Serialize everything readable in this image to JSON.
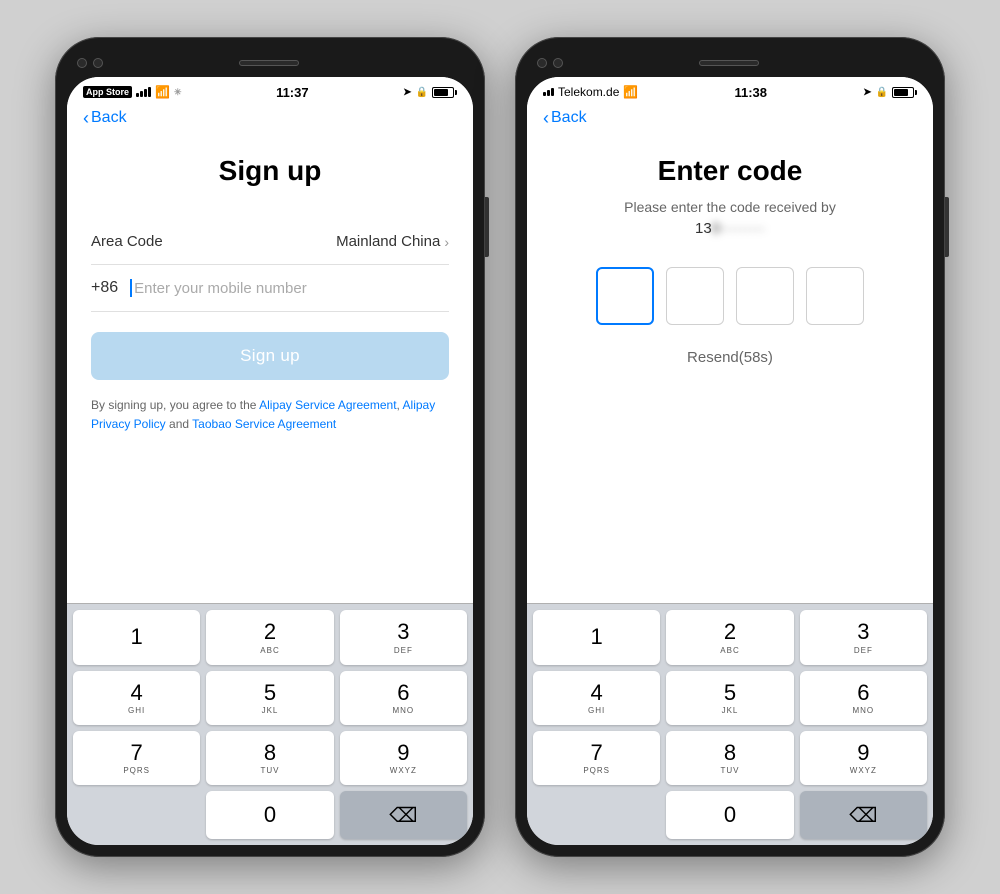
{
  "background_color": "#d0d0d0",
  "phones": [
    {
      "id": "signup-phone",
      "status_bar": {
        "left": "App Store",
        "signal": "••• |",
        "wifi": "wifi",
        "time": "11:37",
        "right_icons": [
          "location",
          "lock",
          "battery"
        ]
      },
      "nav": {
        "back_label": "Back"
      },
      "screen": {
        "title": "Sign up",
        "area_code_label": "Area Code",
        "area_code_value": "Mainland China",
        "country_code": "+86",
        "phone_placeholder": "Enter your mobile number",
        "signup_button": "Sign up",
        "terms_prefix": "By signing up, you agree to the ",
        "terms_link1": "Alipay Service Agreement",
        "terms_mid": ", ",
        "terms_link2": "Alipay Privacy Policy",
        "terms_and": " and ",
        "terms_link3": "Taobao Service Agreement",
        "terms_suffix": "."
      },
      "keyboard": {
        "keys": [
          {
            "num": "1",
            "alpha": ""
          },
          {
            "num": "2",
            "alpha": "ABC"
          },
          {
            "num": "3",
            "alpha": "DEF"
          },
          {
            "num": "4",
            "alpha": "GHI"
          },
          {
            "num": "5",
            "alpha": "JKL"
          },
          {
            "num": "6",
            "alpha": "MNO"
          },
          {
            "num": "7",
            "alpha": "PQRS"
          },
          {
            "num": "8",
            "alpha": "TUV"
          },
          {
            "num": "9",
            "alpha": "WXYZ"
          },
          {
            "num": "",
            "alpha": "",
            "type": "empty"
          },
          {
            "num": "0",
            "alpha": ""
          },
          {
            "num": "⌫",
            "alpha": "",
            "type": "delete"
          }
        ]
      }
    },
    {
      "id": "entercode-phone",
      "status_bar": {
        "left": "Telekom.de",
        "signal": "••• |",
        "wifi": "wifi",
        "time": "11:38",
        "right_icons": [
          "location",
          "lock",
          "battery"
        ]
      },
      "nav": {
        "back_label": "Back"
      },
      "screen": {
        "title": "Enter code",
        "subtitle": "Please enter the code received by",
        "phone_number_start": "13",
        "phone_number_blurred": "0·········",
        "code_boxes": [
          "",
          "",
          "",
          ""
        ],
        "resend_label": "Resend(58s)"
      },
      "keyboard": {
        "keys": [
          {
            "num": "1",
            "alpha": ""
          },
          {
            "num": "2",
            "alpha": "ABC"
          },
          {
            "num": "3",
            "alpha": "DEF"
          },
          {
            "num": "4",
            "alpha": "GHI"
          },
          {
            "num": "5",
            "alpha": "JKL"
          },
          {
            "num": "6",
            "alpha": "MNO"
          },
          {
            "num": "7",
            "alpha": "PQRS"
          },
          {
            "num": "8",
            "alpha": "TUV"
          },
          {
            "num": "9",
            "alpha": "WXYZ"
          },
          {
            "num": "",
            "alpha": "",
            "type": "empty"
          },
          {
            "num": "0",
            "alpha": ""
          },
          {
            "num": "⌫",
            "alpha": "",
            "type": "delete"
          }
        ]
      }
    }
  ]
}
